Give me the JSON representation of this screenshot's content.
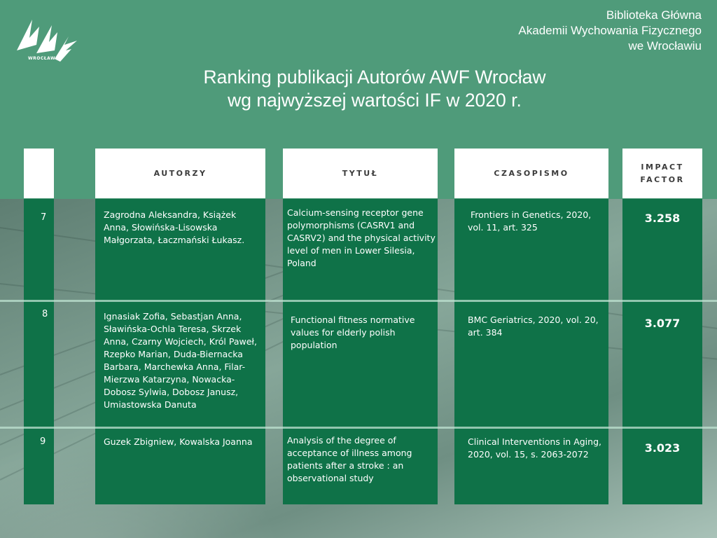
{
  "header": {
    "library_lines": [
      "Biblioteka Główna",
      "Akademii Wychowania Fizycznego",
      "we Wrocławiu"
    ],
    "logo_text": "WROCŁAW",
    "title_lines": [
      "Ranking publikacji Autorów AWF Wrocław",
      "wg najwyższej wartości IF w 2020 r."
    ]
  },
  "table": {
    "columns": {
      "authors": "AUTORZY",
      "title": "TYTUŁ",
      "journal": "CZASOPISMO",
      "impact_line1": "IMPACT",
      "impact_line2": "FACTOR"
    },
    "rows": [
      {
        "rank": "7",
        "authors": "Zagrodna Aleksandra, Książek Anna, Słowińska-Lisowska Małgorzata, Łaczmański Łukasz.",
        "title": "Calcium-sensing receptor gene polymorphisms (CASRV1 and CASRV2) and the physical activity level of men in Lower Silesia, Poland",
        "journal": " Frontiers in Genetics, 2020, vol. 11, art. 325",
        "impact": "3.258"
      },
      {
        "rank": "8",
        "authors": "Ignasiak Zofia, Sebastjan Anna, Sławińska-Ochla Teresa, Skrzek Anna, Czarny Wojciech, Król Paweł, Rzepko Marian, Duda-Biernacka Barbara, Marchewka Anna, Filar-Mierzwa Katarzyna, Nowacka-Dobosz Sylwia, Dobosz Janusz, Umiastowska Danuta",
        "title": "Functional fitness normative values for elderly polish population",
        "journal": "BMC Geriatrics, 2020, vol. 20, art. 384",
        "impact": "3.077"
      },
      {
        "rank": "9",
        "authors": "Guzek Zbigniew, Kowalska Joanna",
        "title": "Analysis of the degree of acceptance of illness among patients after a stroke : an observational study",
        "journal": "Clinical Interventions in Aging, 2020, vol. 15, s. 2063-2072",
        "impact": "3.023"
      }
    ]
  },
  "colors": {
    "background_green": "#4f9b7a",
    "column_green": "#0f7248",
    "header_white": "#ffffff",
    "header_text": "#3c3c3c",
    "separator": "#bfe3d2"
  }
}
